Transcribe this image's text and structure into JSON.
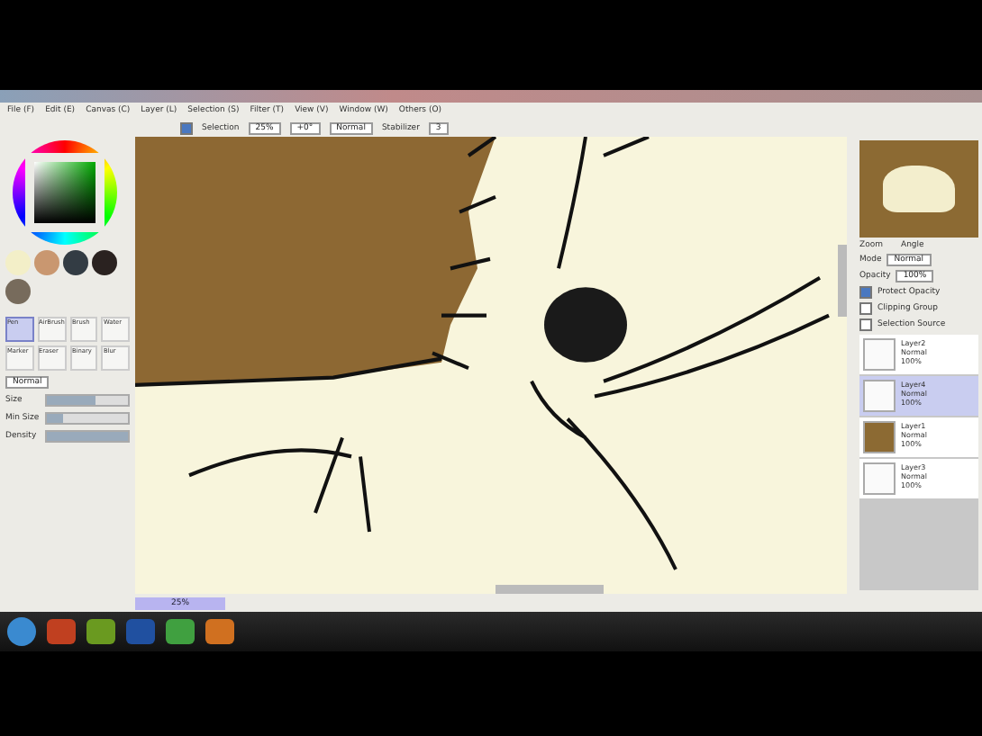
{
  "menu": [
    "File (F)",
    "Edit (E)",
    "Canvas (C)",
    "Layer (L)",
    "Selection (S)",
    "Filter (T)",
    "View (V)",
    "Window (W)",
    "Others (O)"
  ],
  "toolbar": {
    "selection_label": "Selection",
    "selection_checked": true,
    "zoom": "25%",
    "angle": "+0°",
    "blend": "Normal",
    "stabilizer_label": "Stabilizer",
    "stabilizer": "3"
  },
  "tools": [
    {
      "label": "Pen",
      "selected": true
    },
    {
      "label": "AirBrush",
      "selected": false
    },
    {
      "label": "Brush",
      "selected": false
    },
    {
      "label": "Water",
      "selected": false
    },
    {
      "label": "Marker",
      "selected": false
    },
    {
      "label": "Eraser",
      "selected": false
    },
    {
      "label": "Binary",
      "selected": false
    },
    {
      "label": "Blur",
      "selected": false
    }
  ],
  "brush": {
    "mode": "Normal",
    "sliders": [
      {
        "label": "Size",
        "level": 0.6
      },
      {
        "label": "Min Size",
        "level": 0.2
      },
      {
        "label": "Density",
        "level": 1
      }
    ]
  },
  "navigator": {
    "zoom_label": "Zoom",
    "angle_label": "Angle"
  },
  "layer_props": {
    "mode_label": "Mode",
    "mode": "Normal",
    "opacity_label": "Opacity",
    "opacity": "100%",
    "options": [
      {
        "label": "Protect Opacity",
        "checked": true
      },
      {
        "label": "Clipping Group",
        "checked": false
      },
      {
        "label": "Selection Source",
        "checked": false
      }
    ]
  },
  "layers": [
    {
      "name": "Layer2",
      "mode": "Normal",
      "opacity": "100%",
      "kind": "blank",
      "selected": false
    },
    {
      "name": "Layer4",
      "mode": "Normal",
      "opacity": "100%",
      "kind": "blank",
      "selected": true
    },
    {
      "name": "Layer1",
      "mode": "Normal",
      "opacity": "100%",
      "kind": "fill",
      "selected": false
    },
    {
      "name": "Layer3",
      "mode": "Normal",
      "opacity": "100%",
      "kind": "blank",
      "selected": false
    }
  ],
  "document_tab": {
    "zoom": "25%"
  }
}
